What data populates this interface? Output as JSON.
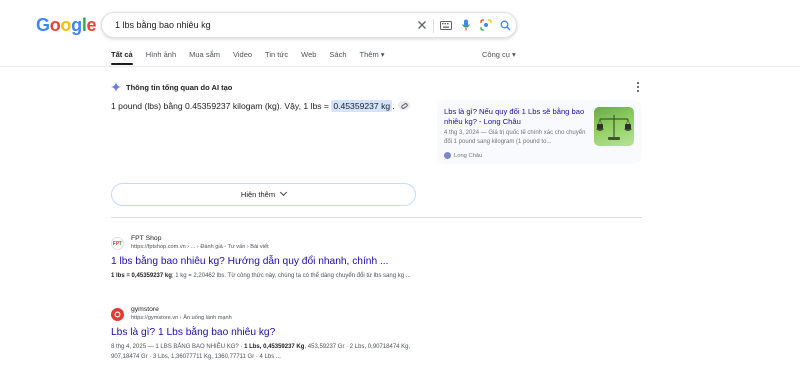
{
  "header": {
    "logo": "Google",
    "query": "1 lbs bằng bao nhiêu kg",
    "tabs": [
      "Tất cả",
      "Hình ảnh",
      "Mua sắm",
      "Video",
      "Tin tức",
      "Web",
      "Sách",
      "Thêm ▾"
    ],
    "tools": "Công cụ ▾"
  },
  "ai_overview": {
    "heading": "Thông tin tổng quan do AI tạo",
    "answer_prefix": "1 pound (lbs) bằng 0.45359237 kilogam (kg). Vậy, 1 lbs = ",
    "answer_highlight": "0.45359237 kg",
    "answer_suffix": ".",
    "card": {
      "title": "Lbs là gì? Nếu quy đổi 1 Lbs sẽ bằng bao nhiêu kg? - Long Châu",
      "snippet": "4 thg 3, 2024 — Giá trị quốc tế chính xác cho chuyển đổi 1 pound sang kilogram (1 pound to...",
      "source": "Long Châu"
    },
    "show_more": "Hiện thêm"
  },
  "results": [
    {
      "site": "FPT Shop",
      "url": "https://fptshop.com.vn › ... › Đánh giá - Tư vấn › Bài viết",
      "title": "1 lbs bằng bao nhiêu kg? Hướng dẫn quy đổi nhanh, chính ...",
      "snippet_bold": "1 lbs = 0,45359237 kg",
      "snippet": "; 1 kg = 2,20462 lbs. Từ công thức này, chúng ta có thể dàng chuyển đổi từ lbs sang kg ..."
    },
    {
      "site": "gymstore",
      "url": "https://gymstore.vn › Ăn uống lành mạnh",
      "title": "Lbs là gì? 1 Lbs bằng bao nhiêu kg?",
      "snippet_date": "8 thg 4, 2025 — 1 LBS BẰNG BAO NHIÊU KG? · ",
      "snippet_bold": "1 Lbs, 0,45359237 Kg",
      "snippet": ", 453,59237 Gr · 2 Lbs, 0,90718474 Kg, 907,18474 Gr · 3 Lbs, 1,36077711 Kg, 1360,77711 Gr · 4 Lbs ..."
    }
  ],
  "colors": {
    "link": "#1a0dab",
    "highlight": "#d3e3fd",
    "google_blue": "#4285F4",
    "google_red": "#EA4335",
    "google_yellow": "#FBBC05",
    "google_green": "#34A853"
  },
  "icons": [
    "clear-icon",
    "keyboard-icon",
    "mic-icon",
    "lens-icon",
    "search-icon",
    "gemini-sparkle-icon",
    "more-vert-icon"
  ]
}
